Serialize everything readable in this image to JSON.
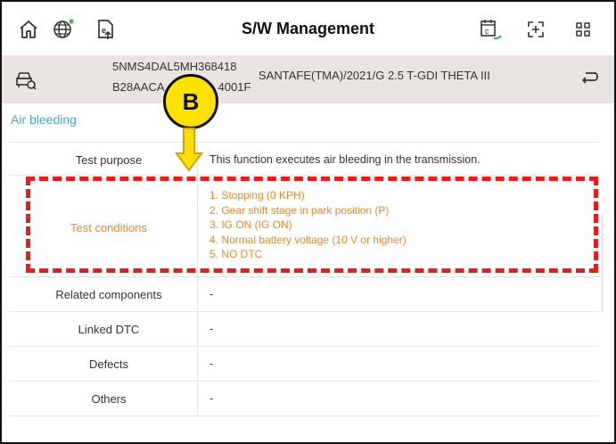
{
  "header": {
    "title": "S/W Management",
    "icons": [
      "home-icon",
      "globe-icon",
      "upload-document-icon",
      "calendar-icon",
      "expand-icon",
      "grid-icon"
    ]
  },
  "vehicle": {
    "vin_line1": "5NMS4DAL5MH368418",
    "vin_line2": "B28AACA",
    "vin_line2_tail": "4001F",
    "model": "SANTAFE(TMA)/2021/G 2.5 T-GDI THETA III"
  },
  "section": {
    "title": "Air bleeding"
  },
  "rows": {
    "test_purpose": {
      "label": "Test purpose",
      "value": "This function executes air bleeding in the transmission."
    },
    "test_conditions": {
      "label": "Test conditions",
      "items": [
        "1. Stopping (0 KPH)",
        "2. Gear shift stage in park position (P)",
        "3. IG ON (IG ON)",
        "4. Normal battery voltage (10 V or higher)",
        "5. NO DTC"
      ]
    },
    "related_components": {
      "label": "Related components",
      "value": "-"
    },
    "linked_dtc": {
      "label": "Linked DTC",
      "value": "-"
    },
    "defects": {
      "label": "Defects",
      "value": "-"
    },
    "others": {
      "label": "Others",
      "value": "-"
    }
  },
  "annotation": {
    "badge_letter": "B",
    "highlight_color": "#e81c1c",
    "badge_color": "#ffe100"
  },
  "colors": {
    "accent": "#4aa3c7",
    "condition_text": "#e8862e",
    "vehicle_bar": "#e8e4e1"
  }
}
